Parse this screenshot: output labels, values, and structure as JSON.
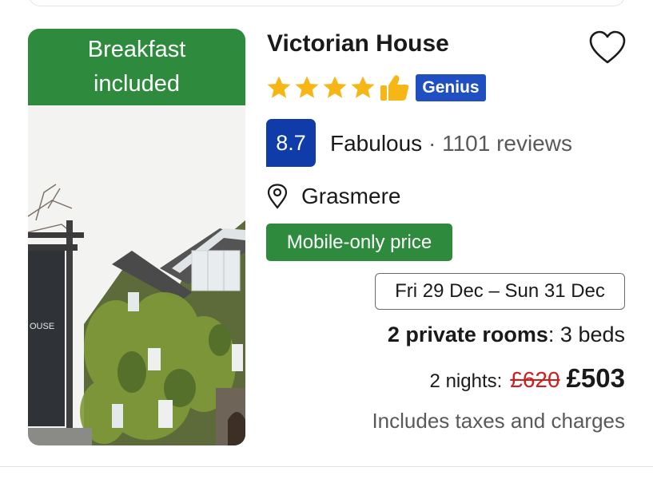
{
  "listing": {
    "badge_line1": "Breakfast",
    "badge_line2": "included",
    "sign_text": "OUSE",
    "name": "Victorian House",
    "star_count": 4,
    "genius_label": "Genius",
    "score": "8.7",
    "rating_word": "Fabulous",
    "rating_sep": " · ",
    "reviews": "1101 reviews",
    "location": "Grasmere",
    "mobile_badge": "Mobile-only price",
    "dates": "Fri 29 Dec – Sun 31 Dec",
    "rooms_bold": "2 private rooms",
    "rooms_rest": ": 3 beds",
    "nights_label": "2 nights:",
    "old_price": "£620",
    "new_price": "£503",
    "taxes_note": "Includes taxes and charges"
  },
  "colors": {
    "accent_green": "#2e8b3d",
    "score_blue": "#0f3ca8",
    "genius_blue": "#1f4fc1",
    "star_yellow": "#f6b716",
    "strike_red": "#cc1f1f"
  },
  "icons": {
    "favorite": "heart-outline-icon",
    "rating_star": "star-icon",
    "preferred": "thumbs-up-icon",
    "location": "map-pin-icon"
  }
}
